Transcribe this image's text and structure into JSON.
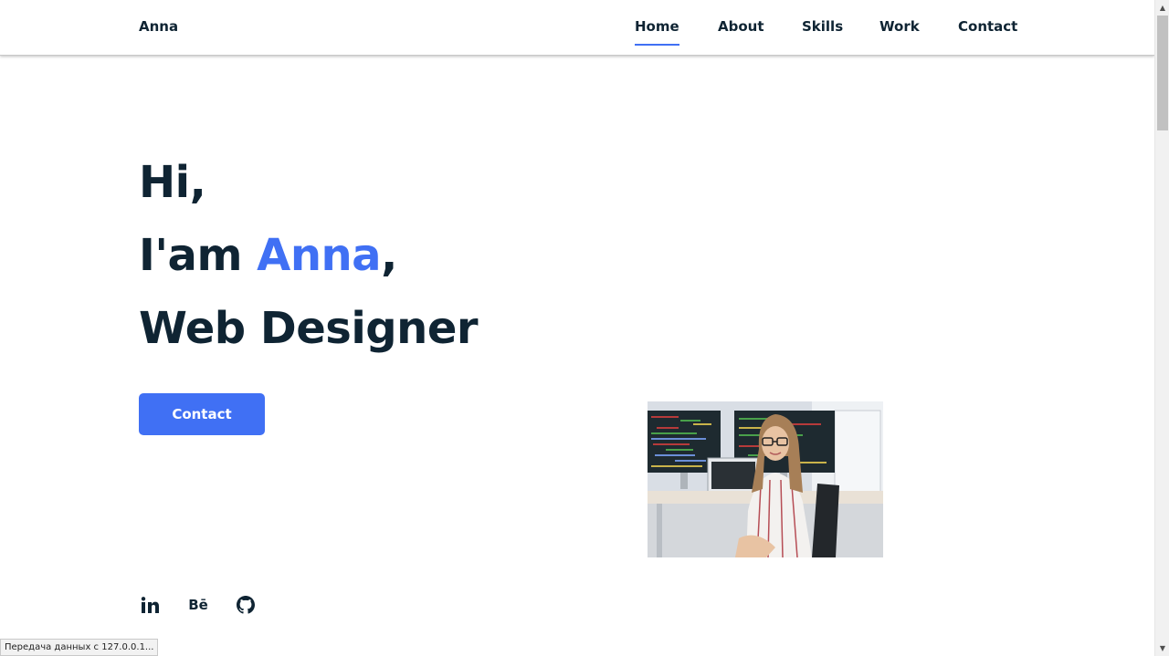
{
  "header": {
    "logo": "Anna",
    "nav": [
      {
        "label": "Home",
        "active": true
      },
      {
        "label": "About",
        "active": false
      },
      {
        "label": "Skills",
        "active": false
      },
      {
        "label": "Work",
        "active": false
      },
      {
        "label": "Contact",
        "active": false
      }
    ]
  },
  "hero": {
    "line1": "Hi,",
    "line2_prefix": "I'am ",
    "line2_name": "Anna",
    "line2_suffix": ",",
    "line3": "Web Designer",
    "button_label": "Contact"
  },
  "socials": [
    {
      "name": "linkedin",
      "glyph": "in"
    },
    {
      "name": "behance",
      "glyph": "Bē"
    },
    {
      "name": "github",
      "glyph": ""
    }
  ],
  "status_bar": {
    "text": "Передача данных с 127.0.0.1..."
  },
  "colors": {
    "accent": "#4070f4",
    "text": "#0f2433"
  }
}
